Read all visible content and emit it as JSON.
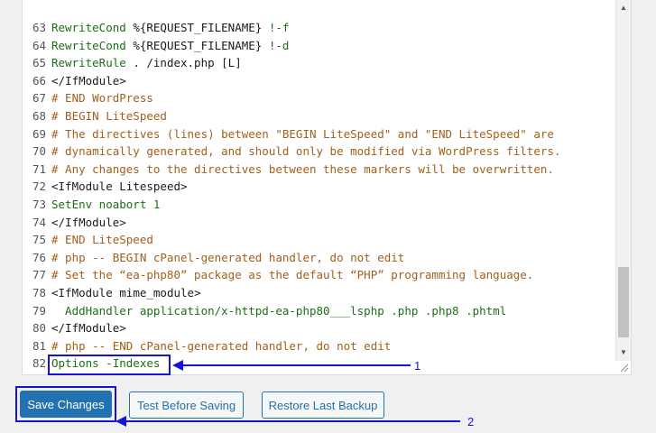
{
  "editor": {
    "lines": [
      {
        "n": "63",
        "segs": [
          [
            "RewriteCond ",
            "kw"
          ],
          [
            "%{REQUEST_FILENAME} ",
            "text"
          ],
          [
            "!-f",
            "kw"
          ]
        ]
      },
      {
        "n": "64",
        "segs": [
          [
            "RewriteCond ",
            "kw"
          ],
          [
            "%{REQUEST_FILENAME} ",
            "text"
          ],
          [
            "!-d",
            "kw"
          ]
        ]
      },
      {
        "n": "65",
        "segs": [
          [
            "RewriteRule ",
            "kw"
          ],
          [
            ". /index.php [L]",
            "text"
          ]
        ]
      },
      {
        "n": "66",
        "segs": [
          [
            "</IfModule>",
            "tag"
          ]
        ]
      },
      {
        "n": "67",
        "segs": [
          [
            "# END WordPress",
            "comment"
          ]
        ]
      },
      {
        "n": "68",
        "segs": [
          [
            "# BEGIN LiteSpeed",
            "comment"
          ]
        ]
      },
      {
        "n": "69",
        "segs": [
          [
            "# The directives (lines) between \"BEGIN LiteSpeed\" and \"END LiteSpeed\" are",
            "comment"
          ]
        ]
      },
      {
        "n": "70",
        "segs": [
          [
            "# dynamically generated, and should only be modified via WordPress filters.",
            "comment"
          ]
        ]
      },
      {
        "n": "71",
        "segs": [
          [
            "# Any changes to the directives between these markers will be overwritten.",
            "comment"
          ]
        ]
      },
      {
        "n": "72",
        "segs": [
          [
            "<IfModule ",
            "tag"
          ],
          [
            "Litespeed",
            "text"
          ],
          [
            ">",
            "tag"
          ]
        ]
      },
      {
        "n": "73",
        "segs": [
          [
            "SetEnv noabort 1",
            "kw"
          ]
        ]
      },
      {
        "n": "74",
        "segs": [
          [
            "</IfModule>",
            "tag"
          ]
        ]
      },
      {
        "n": "75",
        "segs": [
          [
            "# END LiteSpeed",
            "comment"
          ]
        ]
      },
      {
        "n": "76",
        "segs": [
          [
            "# php -- BEGIN cPanel-generated handler, do not edit",
            "comment"
          ]
        ]
      },
      {
        "n": "77",
        "segs": [
          [
            "# Set the “ea-php80” package as the default “PHP” programming language.",
            "comment"
          ]
        ]
      },
      {
        "n": "78",
        "segs": [
          [
            "<IfModule ",
            "tag"
          ],
          [
            "mime_module",
            "text"
          ],
          [
            ">",
            "tag"
          ]
        ]
      },
      {
        "n": "79",
        "segs": [
          [
            "  AddHandler application/x-httpd-ea-php80___lsphp .php .php8 .phtml",
            "kw"
          ]
        ]
      },
      {
        "n": "80",
        "segs": [
          [
            "</IfModule>",
            "tag"
          ]
        ]
      },
      {
        "n": "81",
        "segs": [
          [
            "# php -- END cPanel-generated handler, do not edit",
            "comment"
          ]
        ]
      },
      {
        "n": "82",
        "segs": [
          [
            "Options -Indexes",
            "kw"
          ]
        ]
      }
    ]
  },
  "buttons": {
    "save": "Save Changes",
    "test": "Test Before Saving",
    "restore": "Restore Last Backup"
  },
  "annotations": {
    "one": "1",
    "two": "2"
  },
  "colors": {
    "accent": "#2271b1",
    "annotation": "#1414d8",
    "comment": "#a15f1b",
    "keyword": "#1d6e18"
  },
  "icons": {
    "scroll_up": "chevron-up-icon",
    "scroll_down": "chevron-down-icon",
    "resize": "resize-handle-icon"
  }
}
